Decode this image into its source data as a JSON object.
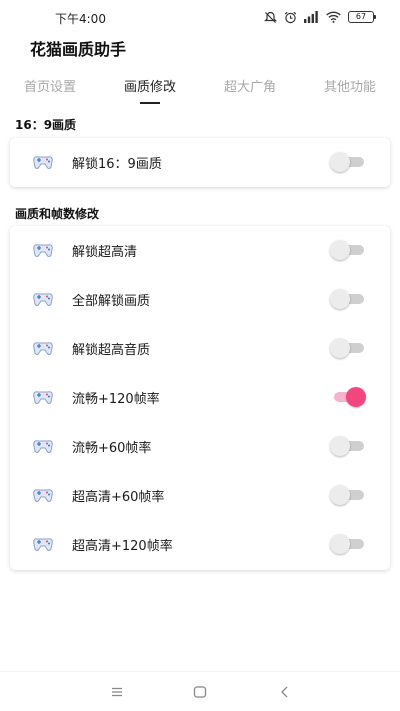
{
  "status_bar": {
    "time": "下午4:00",
    "battery": "67",
    "icons": [
      "mute-icon",
      "alarm-icon",
      "signal-icon",
      "wifi-icon",
      "battery-icon"
    ]
  },
  "app": {
    "title": "花猫画质助手"
  },
  "tabs": [
    {
      "label": "首页设置",
      "active": false
    },
    {
      "label": "画质修改",
      "active": true
    },
    {
      "label": "超大广角",
      "active": false
    },
    {
      "label": "其他功能",
      "active": false
    }
  ],
  "sections": {
    "ratio": {
      "title": "16：9画质",
      "items": [
        {
          "label": "解锁16：9画质",
          "on": false
        }
      ]
    },
    "quality": {
      "title": "画质和帧数修改",
      "items": [
        {
          "label": "解锁超高清",
          "on": false
        },
        {
          "label": "全部解锁画质",
          "on": false
        },
        {
          "label": "解锁超高音质",
          "on": false
        },
        {
          "label": "流畅+120帧率",
          "on": true
        },
        {
          "label": "流畅+60帧率",
          "on": false
        },
        {
          "label": "超高清+60帧率",
          "on": false
        },
        {
          "label": "超高清+120帧率",
          "on": false
        }
      ]
    }
  },
  "colors": {
    "toggle_on_thumb": "#f2467f",
    "toggle_on_track": "#f7b3cd",
    "toggle_off_track": "#cfcfcf",
    "tab_inactive": "#a8a8a8"
  },
  "nav_bar": {
    "buttons": [
      "menu-icon",
      "home-icon",
      "back-icon"
    ]
  }
}
